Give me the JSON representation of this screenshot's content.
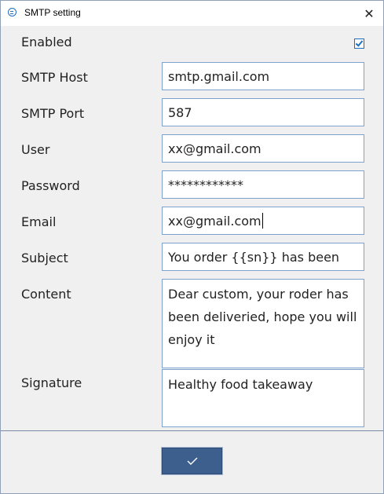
{
  "window": {
    "title": "SMTP setting"
  },
  "form": {
    "enabled": {
      "label": "Enabled",
      "checked": true
    },
    "smtp_host": {
      "label": "SMTP Host",
      "value": "smtp.gmail.com"
    },
    "smtp_port": {
      "label": "SMTP Port",
      "value": "587"
    },
    "user": {
      "label": "User",
      "value": "xx@gmail.com"
    },
    "password": {
      "label": "Password",
      "value": "************"
    },
    "email": {
      "label": "Email",
      "value": "xx@gmail.com"
    },
    "subject": {
      "label": "Subject",
      "value": "You order {{sn}} has been"
    },
    "content": {
      "label": "Content",
      "value": "Dear custom, your roder has been deliveried, hope you will enjoy it"
    },
    "signature": {
      "label": "Signature",
      "value": "Healthy food takeaway"
    }
  },
  "icons": {
    "app": "app-icon",
    "close": "close-icon",
    "confirm": "checkmark-icon"
  },
  "colors": {
    "accent": "#1f6fc0",
    "button_bg": "#3d5f8d",
    "field_border": "#7da2ce"
  }
}
